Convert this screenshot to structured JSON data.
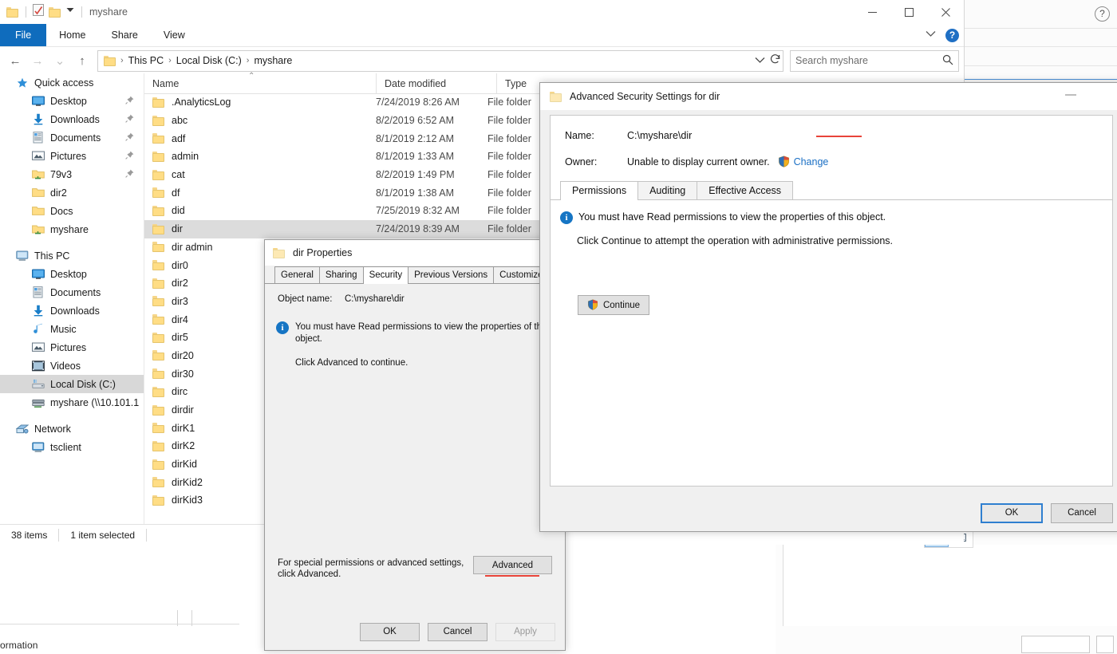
{
  "explorer": {
    "title": "myshare",
    "quick_access_toolbar": [
      {
        "icon": "folder-icon",
        "name": "folder-icon"
      },
      {
        "icon": "properties-icon",
        "name": "properties-icon"
      },
      {
        "icon": "new-folder-icon",
        "name": "new-folder-icon"
      },
      {
        "icon": "chevron-down-icon",
        "name": "customize-qat-chevron-icon"
      }
    ],
    "window_controls": {
      "minimize": "─",
      "maximize": "□",
      "close": "✕"
    },
    "ribbon_tabs": [
      {
        "label": "File",
        "active": true
      },
      {
        "label": "Home",
        "active": false
      },
      {
        "label": "Share",
        "active": false
      },
      {
        "label": "View",
        "active": false
      }
    ],
    "ribbon_right": {
      "collapse_icon": "chevron-down-icon",
      "help_label": "?"
    },
    "address": {
      "back_icon": "←",
      "forward_icon": "→",
      "recent_icon": "⌄",
      "up_icon": "↑",
      "breadcrumbs": [
        "This PC",
        "Local Disk (C:)",
        "myshare"
      ],
      "separator": "›",
      "dropdown_icon": "⌄",
      "refresh_icon": "↻"
    },
    "search": {
      "placeholder": "Search myshare",
      "icon": "search-icon"
    },
    "columns": [
      {
        "label": "Name",
        "sorted": true,
        "sort_icon": "⌃"
      },
      {
        "label": "Date modified",
        "sorted": false
      },
      {
        "label": "Type",
        "sorted": false
      }
    ],
    "files": [
      {
        "name": ".AnalyticsLog",
        "date": "7/24/2019 8:26 AM",
        "type": "File folder",
        "selected": false
      },
      {
        "name": "abc",
        "date": "8/2/2019 6:52 AM",
        "type": "File folder",
        "selected": false
      },
      {
        "name": "adf",
        "date": "8/1/2019 2:12 AM",
        "type": "File folder",
        "selected": false
      },
      {
        "name": "admin",
        "date": "8/1/2019 1:33 AM",
        "type": "File folder",
        "selected": false
      },
      {
        "name": "cat",
        "date": "8/2/2019 1:49 PM",
        "type": "File folder",
        "selected": false
      },
      {
        "name": "df",
        "date": "8/1/2019 1:38 AM",
        "type": "File folder",
        "selected": false
      },
      {
        "name": "did",
        "date": "7/25/2019 8:32 AM",
        "type": "File folder",
        "selected": false
      },
      {
        "name": "dir",
        "date": "7/24/2019 8:39 AM",
        "type": "File folder",
        "selected": true
      },
      {
        "name": "dir admin",
        "date": "",
        "type": "",
        "selected": false
      },
      {
        "name": "dir0",
        "date": "",
        "type": "",
        "selected": false
      },
      {
        "name": "dir2",
        "date": "",
        "type": "",
        "selected": false
      },
      {
        "name": "dir3",
        "date": "",
        "type": "",
        "selected": false
      },
      {
        "name": "dir4",
        "date": "",
        "type": "",
        "selected": false
      },
      {
        "name": "dir5",
        "date": "",
        "type": "",
        "selected": false
      },
      {
        "name": "dir20",
        "date": "",
        "type": "",
        "selected": false
      },
      {
        "name": "dir30",
        "date": "",
        "type": "",
        "selected": false
      },
      {
        "name": "dirc",
        "date": "",
        "type": "",
        "selected": false
      },
      {
        "name": "dirdir",
        "date": "",
        "type": "",
        "selected": false
      },
      {
        "name": "dirK1",
        "date": "",
        "type": "",
        "selected": false
      },
      {
        "name": "dirK2",
        "date": "",
        "type": "",
        "selected": false
      },
      {
        "name": "dirKid",
        "date": "",
        "type": "",
        "selected": false
      },
      {
        "name": "dirKid2",
        "date": "",
        "type": "",
        "selected": false
      },
      {
        "name": "dirKid3",
        "date": "",
        "type": "",
        "selected": false
      }
    ],
    "status": {
      "items_count": "38 items",
      "selection": "1 item selected"
    }
  },
  "navigation": {
    "groups": [
      {
        "header": {
          "label": "Quick access",
          "icon": "star-icon"
        },
        "items": [
          {
            "label": "Desktop",
            "icon": "desktop-icon",
            "pinned": true
          },
          {
            "label": "Downloads",
            "icon": "downloads-icon",
            "pinned": true
          },
          {
            "label": "Documents",
            "icon": "documents-icon",
            "pinned": true
          },
          {
            "label": "Pictures",
            "icon": "pictures-icon",
            "pinned": true
          },
          {
            "label": "79v3",
            "icon": "shared-folder-icon",
            "pinned": true
          },
          {
            "label": "dir2",
            "icon": "folder-icon",
            "pinned": false
          },
          {
            "label": "Docs",
            "icon": "folder-icon",
            "pinned": false
          },
          {
            "label": "myshare",
            "icon": "shared-folder-icon",
            "pinned": false
          }
        ]
      },
      {
        "header": {
          "label": "This PC",
          "icon": "this-pc-icon"
        },
        "items": [
          {
            "label": "Desktop",
            "icon": "desktop-icon",
            "pinned": false
          },
          {
            "label": "Documents",
            "icon": "documents-icon",
            "pinned": false
          },
          {
            "label": "Downloads",
            "icon": "downloads-icon",
            "pinned": false
          },
          {
            "label": "Music",
            "icon": "music-icon",
            "pinned": false
          },
          {
            "label": "Pictures",
            "icon": "pictures-icon",
            "pinned": false
          },
          {
            "label": "Videos",
            "icon": "videos-icon",
            "pinned": false
          },
          {
            "label": "Local Disk (C:)",
            "icon": "drive-icon",
            "pinned": false,
            "selected": true
          },
          {
            "label": "myshare (\\\\10.101.1",
            "icon": "network-drive-icon",
            "pinned": false
          }
        ]
      },
      {
        "header": {
          "label": "Network",
          "icon": "network-icon"
        },
        "items": [
          {
            "label": "tsclient",
            "icon": "computer-icon",
            "pinned": false
          }
        ]
      }
    ]
  },
  "properties_dialog": {
    "title": "dir Properties",
    "icon": "folder-icon",
    "tabs": [
      {
        "label": "General",
        "active": false
      },
      {
        "label": "Sharing",
        "active": false
      },
      {
        "label": "Security",
        "active": true
      },
      {
        "label": "Previous Versions",
        "active": false
      },
      {
        "label": "Customize",
        "active": false
      }
    ],
    "object_name_label": "Object name:",
    "object_name_value": "C:\\myshare\\dir",
    "info_icon": "info-icon",
    "info_text": "You must have Read permissions to view the properties of this object.",
    "sub_note": "Click Advanced to continue.",
    "advanced_note": "For special permissions or advanced settings, click Advanced.",
    "advanced_button": "Advanced",
    "advanced_highlighted": true,
    "footer": {
      "ok": "OK",
      "cancel": "Cancel",
      "apply": "Apply",
      "apply_disabled": true
    }
  },
  "advanced_security_dialog": {
    "title": "Advanced Security Settings for dir",
    "icon": "folder-icon",
    "minimize_icon": "minimize-icon",
    "name_label": "Name:",
    "name_value": "C:\\myshare\\dir",
    "owner_label": "Owner:",
    "owner_value": "Unable to display current owner.",
    "change_link": "Change",
    "change_highlighted": true,
    "shield_icon": "uac-shield-icon",
    "tabs": [
      {
        "label": "Permissions",
        "active": true
      },
      {
        "label": "Auditing",
        "active": false
      },
      {
        "label": "Effective Access",
        "active": false
      }
    ],
    "info_icon": "info-icon",
    "info_text": "You must have Read permissions to view the properties of this object.",
    "note_text": "Click Continue to attempt the operation with administrative permissions.",
    "continue_button": "Continue",
    "footer": {
      "ok": "OK",
      "cancel": "Cancel"
    }
  },
  "background_windows": {
    "right_help_icon": "help-icon",
    "lower_view_buttons": [
      {
        "name": "details-view-icon",
        "selected": true
      },
      {
        "name": "large-icons-view-icon",
        "selected": false
      }
    ],
    "clipped_bottom_text": "ormation"
  },
  "colors": {
    "accent_blue": "#0f6cbd",
    "link_blue": "#1a6fc4",
    "highlight_red": "#e8443a",
    "selection_gray": "#dcdcdc",
    "folder_yellow": "#ffdd85"
  }
}
